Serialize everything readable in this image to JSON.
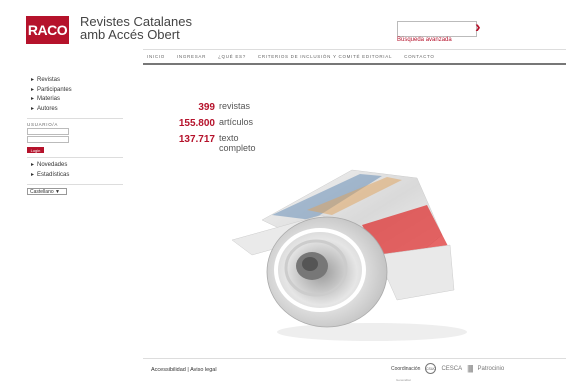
{
  "header": {
    "logo_text": "RACO",
    "title_line1": "Revistes Catalanes",
    "title_line2": "amb Accés Obert",
    "search_value": "",
    "search_go_icon": "chevron-right-icon",
    "advanced_search": "Búsqueda avanzada"
  },
  "nav": {
    "items": [
      "INICIO",
      "INGRESAR",
      "¿QUÉ ES?",
      "CRITERIOS DE INCLUSIÓN Y COMITÉ EDITORIAL",
      "CONTACTO"
    ]
  },
  "sidebar": {
    "links_top": [
      "Revistas",
      "Participantes",
      "Materias",
      "Autores"
    ],
    "user_label": "USUARIO/A",
    "login_label": "Login",
    "links_bottom": [
      "Novedades",
      "Estadísticas"
    ],
    "language": "Castellano ▼"
  },
  "stats": [
    {
      "value": "399",
      "label": "revistas"
    },
    {
      "value": "155.800",
      "label": "artículos"
    },
    {
      "value": "137.717",
      "label_line1": "texto",
      "label_line2": "completo"
    }
  ],
  "footer": {
    "accessibility": "Accessibilidad",
    "separator": "|",
    "legal": "Aviso legal",
    "coordination": "Coordinación",
    "cbuc_logo": "CSUC",
    "cesca_logo": "CESCA",
    "patronage": "Patrocinio",
    "small_text": "Generalitat"
  },
  "colors": {
    "accent": "#b5122b",
    "nav_border": "#777777"
  }
}
